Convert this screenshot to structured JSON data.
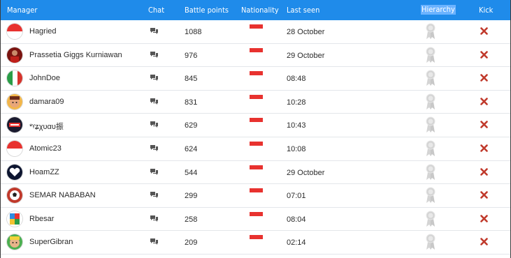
{
  "header": {
    "manager": "Manager",
    "chat": "Chat",
    "battle_points": "Battle points",
    "nationality": "Nationality",
    "last_seen": "Last seen",
    "hierarchy": "Hierarchy",
    "kick": "Kick"
  },
  "colors": {
    "header_bg": "#1f8bea",
    "flag_red": "#e8322f",
    "kick_red": "#c0392b",
    "chat_icon": "#555555",
    "medal": "#d4d4d4"
  },
  "icons": {
    "chat": "chat-bubbles-icon",
    "hierarchy": "medal-ribbon-icon",
    "kick": "kick-x-icon",
    "nationality": "indonesia-flag-icon"
  },
  "rows": [
    {
      "manager": "Hagried",
      "battle_points": "1088",
      "last_seen": "28 October",
      "avatar": "indonesia-flag-avatar"
    },
    {
      "manager": "Prassetia Giggs Kurniawan",
      "battle_points": "976",
      "last_seen": "29 October",
      "avatar": "player-photo-avatar"
    },
    {
      "manager": "JohnDoe",
      "battle_points": "845",
      "last_seen": "08:48",
      "avatar": "italy-flag-avatar"
    },
    {
      "manager": "damara09",
      "battle_points": "831",
      "last_seen": "10:28",
      "avatar": "cartoon-face-avatar"
    },
    {
      "manager": "*ᵞʑχυαυ振",
      "battle_points": "629",
      "last_seen": "10:43",
      "avatar": "dark-crest-avatar"
    },
    {
      "manager": "Atomic23",
      "battle_points": "624",
      "last_seen": "10:08",
      "avatar": "indonesia-flag-avatar"
    },
    {
      "manager": "HoamZZ",
      "battle_points": "544",
      "last_seen": "29 October",
      "avatar": "dark-heart-avatar"
    },
    {
      "manager": "SEMAR NABABAN",
      "battle_points": "299",
      "last_seen": "07:01",
      "avatar": "football-avatar"
    },
    {
      "manager": "Rbesar",
      "battle_points": "258",
      "last_seen": "08:04",
      "avatar": "colorful-logo-avatar"
    },
    {
      "manager": "SuperGibran",
      "battle_points": "209",
      "last_seen": "02:14",
      "avatar": "cartoon-green-avatar"
    }
  ]
}
